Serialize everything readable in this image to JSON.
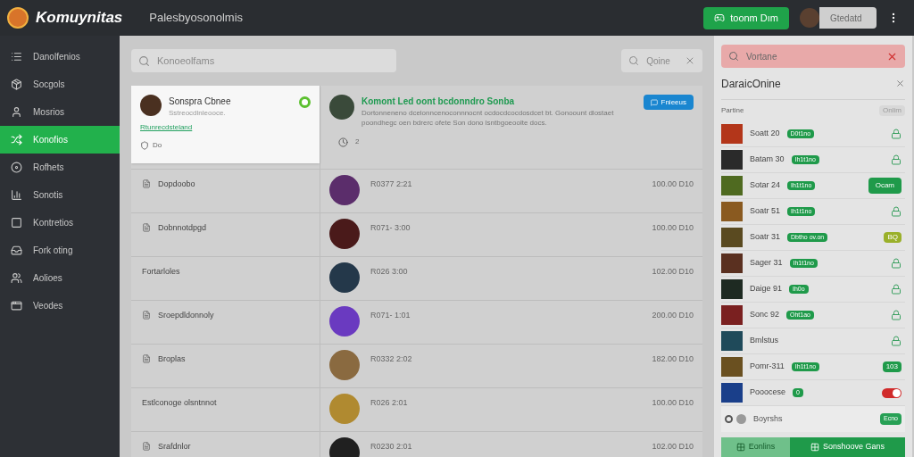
{
  "header": {
    "brand": "Komuynitas",
    "subtitle": "Palesbyosonolmis",
    "action_button": "toonm Dım",
    "user_name": "Gtedatd"
  },
  "sidebar": {
    "items": [
      {
        "label": "Danolfenios",
        "selected": false
      },
      {
        "label": "Socgols",
        "selected": false
      },
      {
        "label": "Mosrios",
        "selected": false
      },
      {
        "label": "Konofios",
        "selected": true
      },
      {
        "label": "Rofhets",
        "selected": false
      },
      {
        "label": "Sonotis",
        "selected": false
      },
      {
        "label": "Kontretios",
        "selected": false
      },
      {
        "label": "Fork oting",
        "selected": false
      },
      {
        "label": "Aolioes",
        "selected": false
      },
      {
        "label": "Veodes",
        "selected": false
      }
    ]
  },
  "search": {
    "placeholder": "Konoeolfams"
  },
  "filter": {
    "placeholder": "Qoine"
  },
  "selected_card": {
    "name": "Sonspra Cbnee",
    "subtitle": "Sstreocdlnleooce.",
    "link": "Rtunrecdsteland",
    "tag": "Do",
    "online": true
  },
  "detail": {
    "title": "Komont Led oont bcdonndro Sonba",
    "text": "Dortonneneno dcelonncenoconnnocnt ocdocdcocdosdcet bt. Gonoount dlostaet poondhegc oen bdrerc ofete Son dono lsntbgoeoolte docs.",
    "button": "Fnieeus",
    "count": "2"
  },
  "rows": [
    {
      "label": "Dopdoobo",
      "kind": "file",
      "time": "R0377 2:21",
      "amount": "100.00 D10"
    },
    {
      "label": "Dobnnotdpgd",
      "kind": "file",
      "time": "R071- 3:00",
      "amount": "100.00 D10"
    },
    {
      "label": "Fortarloles",
      "kind": "plain",
      "time": "R026 3:00",
      "amount": "102.00 D10"
    },
    {
      "label": "Sroepdldonnoly",
      "kind": "file",
      "time": "R071- 1:01",
      "amount": "200.00 D10"
    },
    {
      "label": "Broplas",
      "kind": "file",
      "time": "R0332 2:02",
      "amount": "182.00 D10"
    },
    {
      "label": "Estlconoge olsntnnot",
      "kind": "plain",
      "time": "R026 2:01",
      "amount": "100.00 D10"
    },
    {
      "label": "Srafdnlor",
      "kind": "file",
      "time": "R0230 2:01",
      "amount": "102.00 D10"
    }
  ],
  "panel": {
    "search": "Vortane",
    "title": "DaraicOnine",
    "section": "Partine",
    "section_tag": "Onlim",
    "items": [
      {
        "name": "Soatt 20",
        "badge": "D0t1no",
        "action": {
          "kind": "lock"
        }
      },
      {
        "name": "Batam 30",
        "badge": "Ih1t1no",
        "action": {
          "kind": "lock"
        }
      },
      {
        "name": "Sotar 24",
        "badge": "Ih1t1no",
        "action": {
          "kind": "button",
          "label": "Ocam"
        }
      },
      {
        "name": "Soatr 51",
        "badge": "Ih1t1no",
        "action": {
          "kind": "lock"
        }
      },
      {
        "name": "Soatr 31",
        "badge": "Dbtho ov.on",
        "action": {
          "kind": "chip",
          "label": "BQ"
        }
      },
      {
        "name": "Sager 31",
        "badge": "Ih1t1no",
        "action": {
          "kind": "lock"
        }
      },
      {
        "name": "Daige 91",
        "badge": "Ih0o",
        "action": {
          "kind": "lock"
        }
      },
      {
        "name": "Sonc 92",
        "badge": "Oht1ao",
        "action": {
          "kind": "lock"
        }
      },
      {
        "name": "Bmlstus",
        "action": {
          "kind": "lock"
        }
      },
      {
        "name": "Pomr-311",
        "badge": "Ih1t1no",
        "action": {
          "kind": "count",
          "label": "103"
        }
      },
      {
        "name": "Pooocese",
        "badge": "0",
        "action": {
          "kind": "toggle",
          "on": true
        }
      }
    ],
    "filter_row": {
      "label": "Boyrshs",
      "button": "Ecno"
    },
    "footer": {
      "secondary": "Eonlins",
      "primary": "Sonshoove Gans"
    }
  }
}
